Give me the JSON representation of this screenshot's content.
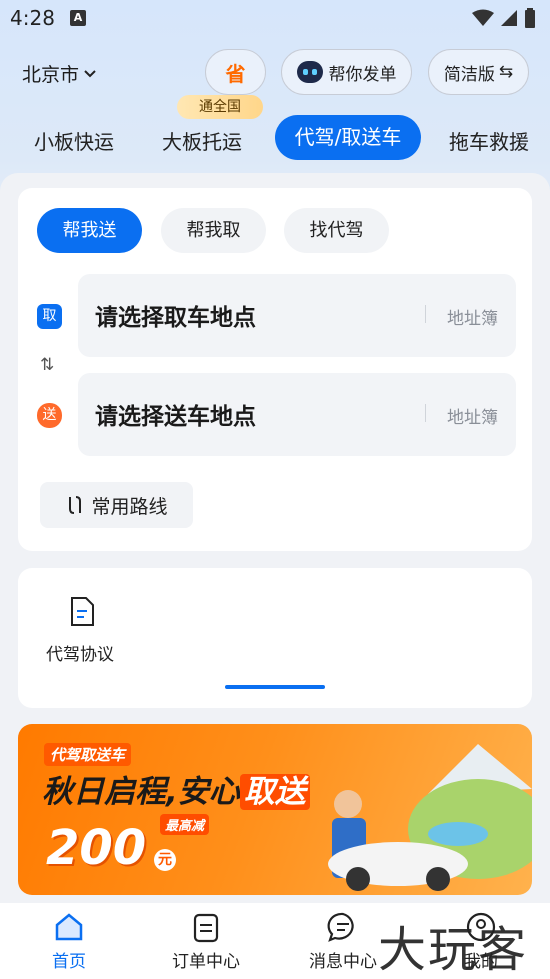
{
  "status_bar": {
    "time": "4:28",
    "notif_letter": "A"
  },
  "header": {
    "city": "北京市",
    "save_label": "省",
    "help_order_label": "帮你发单",
    "simple_mode_label": "简洁版",
    "simple_mode_icon": "⇆"
  },
  "categories": {
    "badge": "通全国",
    "items": [
      {
        "label": "小板快运"
      },
      {
        "label": "大板托运"
      },
      {
        "label": "代驾/取送车",
        "active": true
      },
      {
        "label": "拖车救援"
      }
    ]
  },
  "service_tabs": [
    {
      "label": "帮我送",
      "active": true
    },
    {
      "label": "帮我取"
    },
    {
      "label": "找代驾"
    }
  ],
  "addresses": {
    "pickup": {
      "tag": "取",
      "placeholder": "请选择取车地点",
      "book": "地址簿"
    },
    "dropoff": {
      "tag": "送",
      "placeholder": "请选择送车地点",
      "book": "地址簿"
    },
    "swap_icon": "⇅"
  },
  "common_route_label": "常用路线",
  "agreement": {
    "label": "代驾协议"
  },
  "banner": {
    "tag": "代驾取送车",
    "title_part1": "秋日启程,安心",
    "title_highlight": "取送",
    "max_label": "最高减",
    "amount": "200",
    "unit": "元"
  },
  "bottom_nav": [
    {
      "label": "首页",
      "icon": "home-icon",
      "active": true
    },
    {
      "label": "订单中心",
      "icon": "order-icon"
    },
    {
      "label": "消息中心",
      "icon": "message-icon"
    },
    {
      "label": "我的",
      "icon": "profile-icon"
    }
  ],
  "watermark": "大玩客",
  "colors": {
    "accent": "#0a6ff1",
    "orange": "#ff6a00"
  }
}
